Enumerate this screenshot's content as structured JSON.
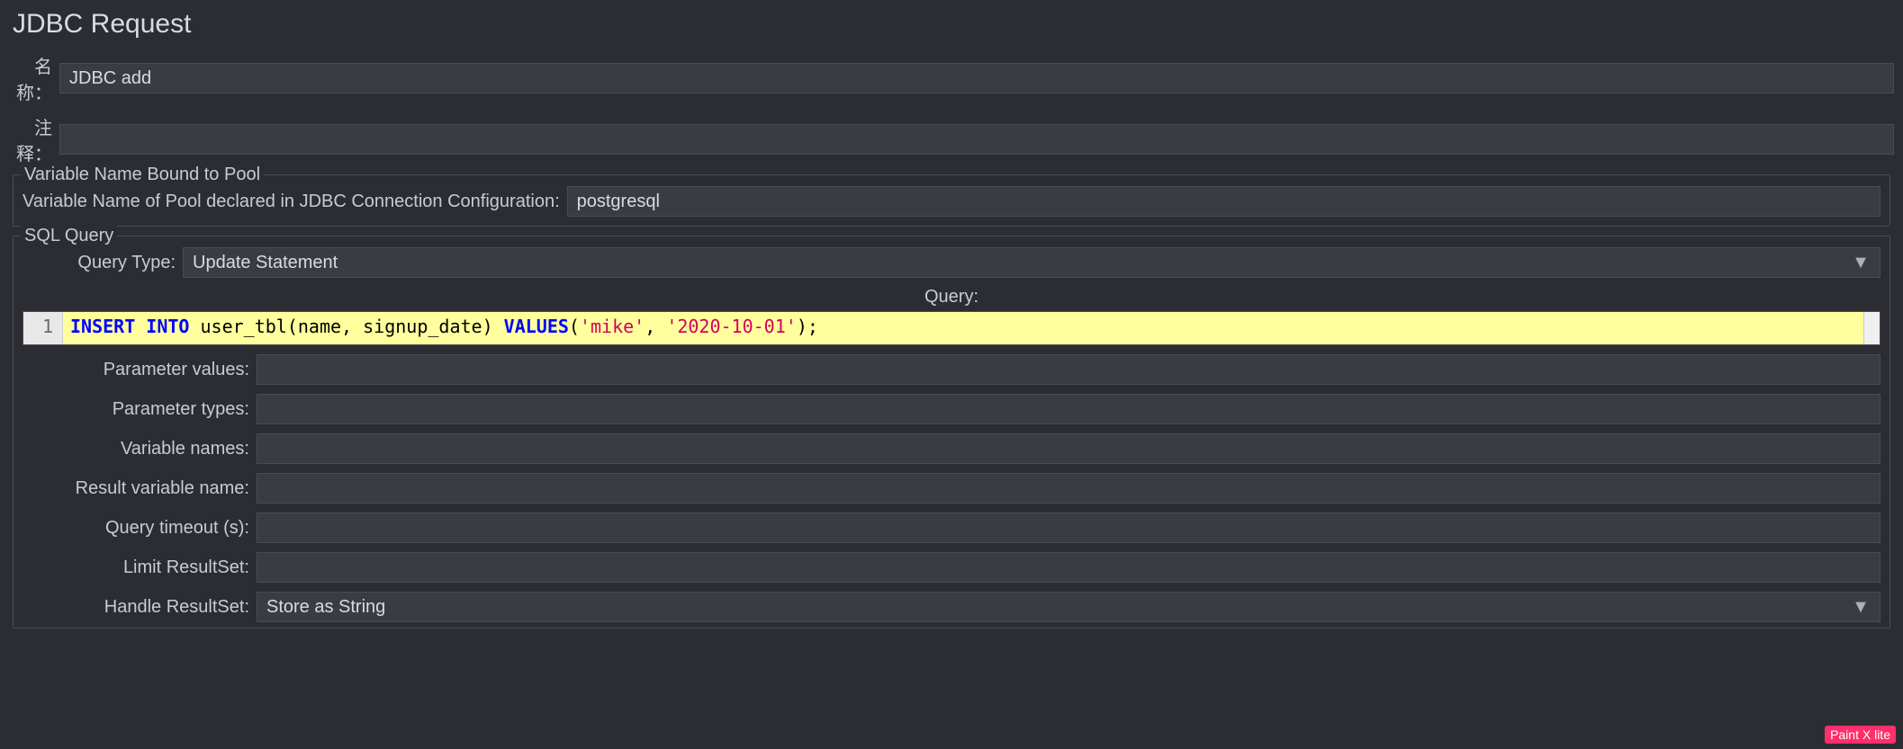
{
  "header": {
    "title": "JDBC Request"
  },
  "name_field": {
    "label": "名称：",
    "value": "JDBC add"
  },
  "comment_field": {
    "label": "注释：",
    "value": ""
  },
  "pool_group": {
    "legend": "Variable Name Bound to Pool",
    "label": "Variable Name of Pool declared in JDBC Connection Configuration:",
    "value": "postgresql"
  },
  "sql_group": {
    "legend": "SQL Query",
    "query_type": {
      "label": "Query Type:",
      "value": "Update Statement"
    },
    "query_label": "Query:",
    "editor": {
      "line_number": "1",
      "tokens": {
        "t1": "INSERT INTO",
        "t2": " user_tbl",
        "t3": "(",
        "t4": "name, signup_date",
        "t5": ")",
        "t6": " ",
        "t7": "VALUES",
        "t8": "(",
        "t9": "'mike'",
        "t10": ", ",
        "t11": "'2020-10-01'",
        "t12": ")",
        "t13": ";"
      }
    },
    "fields": {
      "parameter_values": {
        "label": "Parameter values:",
        "value": ""
      },
      "parameter_types": {
        "label": "Parameter types:",
        "value": ""
      },
      "variable_names": {
        "label": "Variable names:",
        "value": ""
      },
      "result_variable": {
        "label": "Result variable name:",
        "value": ""
      },
      "query_timeout": {
        "label": "Query timeout (s):",
        "value": ""
      },
      "limit_resultset": {
        "label": "Limit ResultSet:",
        "value": ""
      },
      "handle_resultset": {
        "label": "Handle ResultSet:",
        "value": "Store as String"
      }
    }
  },
  "watermark": "Paint X lite"
}
